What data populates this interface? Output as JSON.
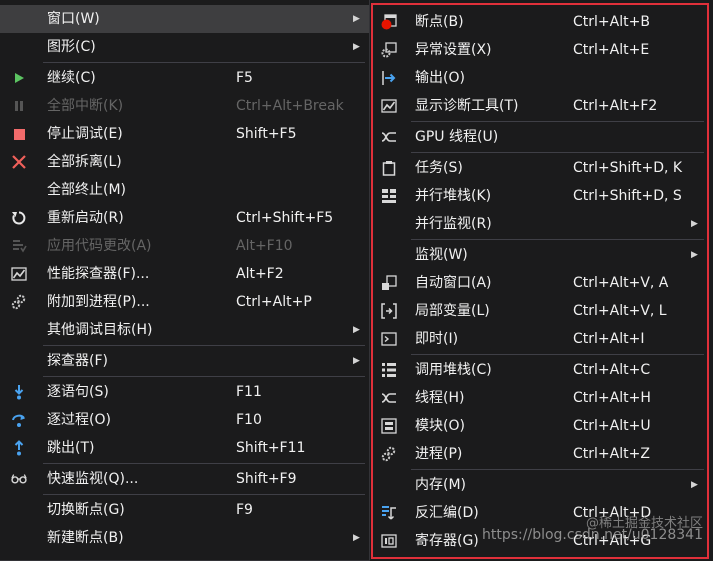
{
  "main_menu": {
    "window": {
      "label": "窗口(W)"
    },
    "graphics": {
      "label": "图形(C)"
    },
    "continue": {
      "label": "继续(C)",
      "shortcut": "F5"
    },
    "break_all": {
      "label": "全部中断(K)",
      "shortcut": "Ctrl+Alt+Break"
    },
    "stop": {
      "label": "停止调试(E)",
      "shortcut": "Shift+F5"
    },
    "detach_all": {
      "label": "全部拆离(L)"
    },
    "terminate_all": {
      "label": "全部终止(M)"
    },
    "restart": {
      "label": "重新启动(R)",
      "shortcut": "Ctrl+Shift+F5"
    },
    "apply_code": {
      "label": "应用代码更改(A)",
      "shortcut": "Alt+F10"
    },
    "profiler": {
      "label": "性能探查器(F)...",
      "shortcut": "Alt+F2"
    },
    "attach": {
      "label": "附加到进程(P)...",
      "shortcut": "Ctrl+Alt+P"
    },
    "other_targets": {
      "label": "其他调试目标(H)"
    },
    "explorer": {
      "label": "探查器(F)"
    },
    "step_into": {
      "label": "逐语句(S)",
      "shortcut": "F11"
    },
    "step_over": {
      "label": "逐过程(O)",
      "shortcut": "F10"
    },
    "step_out": {
      "label": "跳出(T)",
      "shortcut": "Shift+F11"
    },
    "quick_watch": {
      "label": "快速监视(Q)...",
      "shortcut": "Shift+F9"
    },
    "toggle_bp": {
      "label": "切换断点(G)",
      "shortcut": "F9"
    },
    "new_bp": {
      "label": "新建断点(B)"
    }
  },
  "window_menu": {
    "breakpoints": {
      "label": "断点(B)",
      "shortcut": "Ctrl+Alt+B"
    },
    "exception_settings": {
      "label": "异常设置(X)",
      "shortcut": "Ctrl+Alt+E"
    },
    "output": {
      "label": "输出(O)"
    },
    "diagnostic_tools": {
      "label": "显示诊断工具(T)",
      "shortcut": "Ctrl+Alt+F2"
    },
    "gpu_threads": {
      "label": "GPU 线程(U)"
    },
    "tasks": {
      "label": "任务(S)",
      "shortcut": "Ctrl+Shift+D, K"
    },
    "parallel_stacks": {
      "label": "并行堆栈(K)",
      "shortcut": "Ctrl+Shift+D, S"
    },
    "parallel_watch": {
      "label": "并行监视(R)"
    },
    "watch": {
      "label": "监视(W)"
    },
    "autos": {
      "label": "自动窗口(A)",
      "shortcut": "Ctrl+Alt+V, A"
    },
    "locals": {
      "label": "局部变量(L)",
      "shortcut": "Ctrl+Alt+V, L"
    },
    "immediate": {
      "label": "即时(I)",
      "shortcut": "Ctrl+Alt+I"
    },
    "call_stack": {
      "label": "调用堆栈(C)",
      "shortcut": "Ctrl+Alt+C"
    },
    "threads": {
      "label": "线程(H)",
      "shortcut": "Ctrl+Alt+H"
    },
    "modules": {
      "label": "模块(O)",
      "shortcut": "Ctrl+Alt+U"
    },
    "processes": {
      "label": "进程(P)",
      "shortcut": "Ctrl+Alt+Z"
    },
    "memory": {
      "label": "内存(M)"
    },
    "disassembly": {
      "label": "反汇编(D)",
      "shortcut": "Ctrl+Alt+D"
    },
    "registers": {
      "label": "寄存器(G)",
      "shortcut": "Ctrl+Alt+G"
    }
  },
  "watermark": "https://blog.csdn.net/u0128341",
  "watermark2": "@稀土掘金技术社区",
  "submenu_arrow": "▶",
  "colors": {
    "menu_bg": "#1b1b1c",
    "highlight": "#3e3e40",
    "separator": "#3f3f46",
    "submenu_border": "#e0303a",
    "disabled_text": "#656565"
  }
}
